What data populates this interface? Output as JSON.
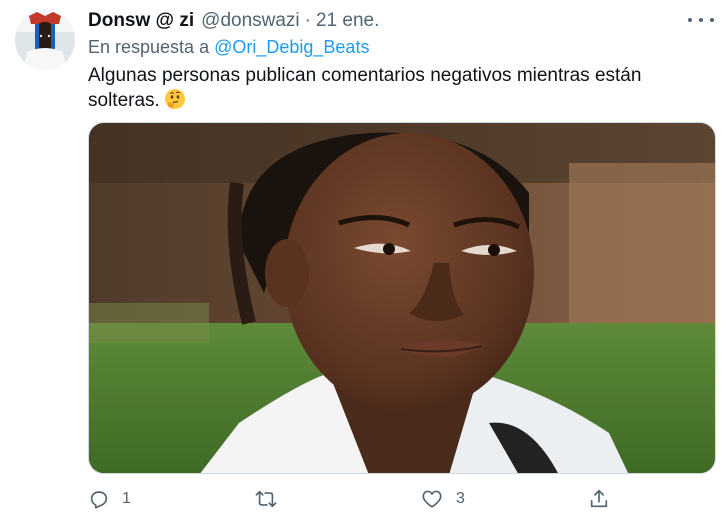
{
  "tweet": {
    "display_name": "Donsw @ zi",
    "handle": "@donswazi",
    "separator": "·",
    "date": "21 ene.",
    "reply_prefix": "En respuesta a",
    "reply_to": "@Ori_Debig_Beats",
    "text": "Algunas personas publican comentarios negativos mientras están solteras.",
    "emoji_icon": "thinking-face-icon",
    "media_icon": "image"
  },
  "actions": {
    "reply_count": "1",
    "retweet_count": "",
    "like_count": "3"
  },
  "colors": {
    "link": "#1d9bf0",
    "muted": "#536471",
    "text": "#0f1419"
  }
}
